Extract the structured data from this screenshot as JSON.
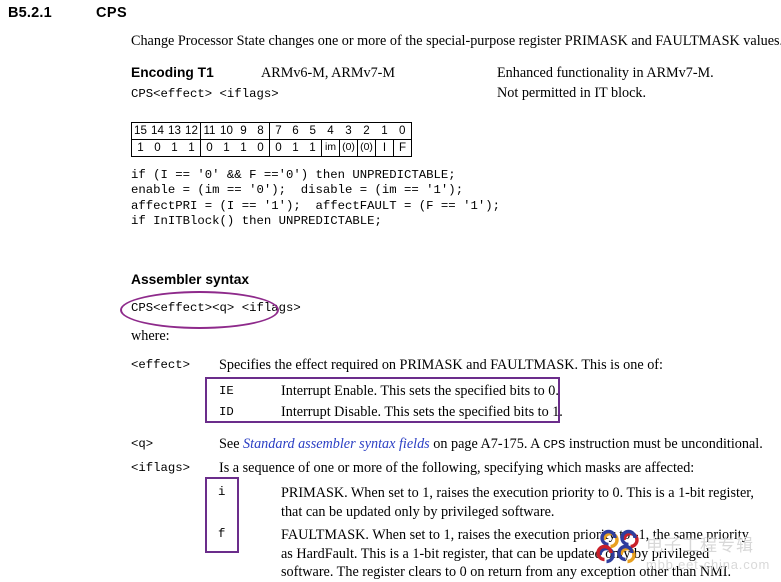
{
  "header": {
    "section_number": "B5.2.1",
    "section_title": "CPS"
  },
  "intro": "Change Processor State changes one or more of the special-purpose register PRIMASK and FAULTMASK values.",
  "encoding": {
    "heading": "Encoding T1",
    "architectures": "ARMv6-M, ARMv7-M",
    "note_line1": "Enhanced functionality in ARMv7-M.",
    "note_line2": "Not permitted in IT block.",
    "syntax": "CPS<effect> <iflags>"
  },
  "bit_table": {
    "bit_numbers": [
      "15",
      "14",
      "13",
      "12",
      "11",
      "10",
      "9",
      "8",
      "7",
      "6",
      "5",
      "4",
      "3",
      "2",
      "1",
      "0"
    ],
    "bit_values": [
      "1",
      "0",
      "1",
      "1",
      "0",
      "1",
      "1",
      "0",
      "0",
      "1",
      "1",
      "im",
      "(0)",
      "(0)",
      "I",
      "F"
    ]
  },
  "pseudocode": "if (I == '0' && F =='0') then UNPREDICTABLE;\nenable = (im == '0');  disable = (im == '1');\naffectPRI = (I == '1');  affectFAULT = (F == '1');\nif InITBlock() then UNPREDICTABLE;",
  "assembler": {
    "heading": "Assembler syntax",
    "syntax_line": "CPS<effect><q> <iflags>",
    "where_label": "where:"
  },
  "definitions": {
    "effect": {
      "label": "<effect>",
      "description": "Specifies the effect required on PRIMASK and FAULTMASK. This is one of:",
      "options": [
        {
          "name": "IE",
          "description": "Interrupt Enable. This sets the specified bits to 0."
        },
        {
          "name": "ID",
          "description": "Interrupt Disable. This sets the specified bits to 1."
        }
      ]
    },
    "q": {
      "label": "<q>",
      "text_before": "See ",
      "xref": "Standard assembler syntax fields",
      "text_middle": " on page A7-175. A ",
      "mono": "CPS",
      "text_after": " instruction must be unconditional."
    },
    "iflags": {
      "label": "<iflags>",
      "description": "Is a sequence of one or more of the following, specifying which masks are affected:",
      "flags": [
        {
          "name": "i",
          "description": "PRIMASK. When set to 1, raises the execution priority to 0. This is a 1-bit register, that can be updated only by privileged software."
        },
        {
          "name": "f",
          "description": "FAULTMASK. When set to 1, raises the execution priority to -1, the same priority as HardFault. This is a 1-bit register, that can be updated only by privileged software. The register clears to 0 on return from any exception other than NMI."
        }
      ]
    }
  },
  "watermark": {
    "chinese_text": "电子工程专辑",
    "url": "mbb.eet-china.com"
  },
  "colors": {
    "annotation_ellipse": "#8e2a8b",
    "annotation_box": "#6b2d8b",
    "crossref_link": "#2b3fc4",
    "watermark_text": "#d9d9d9"
  }
}
